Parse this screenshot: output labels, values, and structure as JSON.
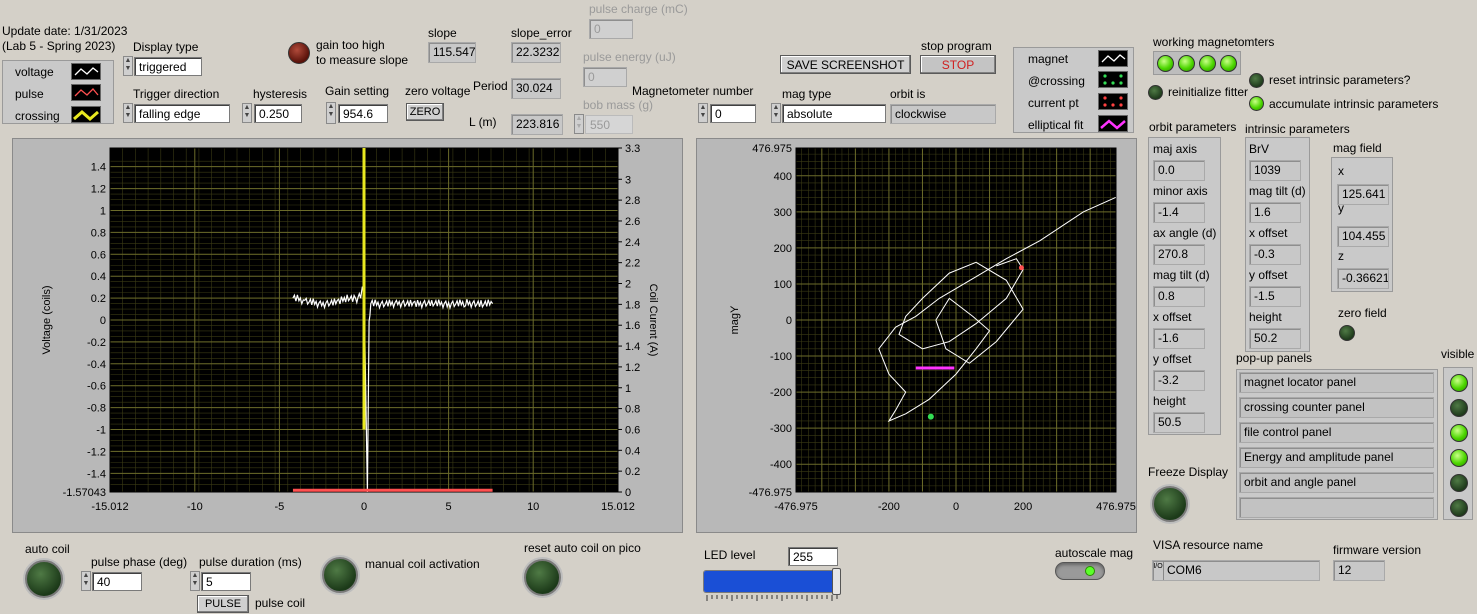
{
  "header": {
    "update_date": "Update date: 1/31/2023",
    "lab": "(Lab 5 - Spring 2023)"
  },
  "legend_left": {
    "items": [
      {
        "label": "voltage"
      },
      {
        "label": "pulse"
      },
      {
        "label": "crossing"
      }
    ]
  },
  "display_type": {
    "label": "Display type",
    "value": "triggered"
  },
  "trigger_direction": {
    "label": "Trigger direction",
    "value": "falling edge"
  },
  "hysteresis": {
    "label": "hysteresis",
    "value": "0.250"
  },
  "gain_setting": {
    "label": "Gain setting",
    "value": "954.6"
  },
  "gain_warning": {
    "line1": "gain too high",
    "line2": "to measure slope"
  },
  "zero_voltage": {
    "label": "zero voltage",
    "button": "ZERO"
  },
  "slope": {
    "label": "slope",
    "value": "115.547"
  },
  "slope_error": {
    "label": "slope_error",
    "value": "22.3232"
  },
  "period": {
    "label": "Period",
    "value": "30.024"
  },
  "length": {
    "label": "L (m)",
    "value": "223.816"
  },
  "pulse_charge": {
    "label": "pulse charge (mC)",
    "value": "0"
  },
  "pulse_energy": {
    "label": "pulse energy (uJ)",
    "value": "0"
  },
  "bob_mass": {
    "label": "bob mass (g)",
    "value": "550"
  },
  "magnetometer_number": {
    "label": "Magnetometer number",
    "value": "0"
  },
  "mag_type": {
    "label": "mag type",
    "value": "absolute"
  },
  "orbit_is": {
    "label": "orbit is",
    "value": "clockwise"
  },
  "save_screenshot": {
    "label": "SAVE SCREENSHOT"
  },
  "stop_program": {
    "label": "stop program",
    "button": "STOP"
  },
  "legend_right": {
    "items": [
      {
        "label": "magnet"
      },
      {
        "label": "@crossing"
      },
      {
        "label": "current pt"
      },
      {
        "label": "elliptical fit"
      }
    ]
  },
  "working_magnetometers": {
    "label": "working magnetomters",
    "states": [
      true,
      true,
      true,
      true
    ]
  },
  "reinitialize_fitter": {
    "label": "reinitialize fitter"
  },
  "reset_intrinsic": {
    "label": "reset intrinsic parameters?"
  },
  "accumulate_intrinsic": {
    "label": "accumulate intrinsic parameters"
  },
  "orbit_parameters": {
    "title": "orbit parameters",
    "fields": [
      {
        "label": "maj axis",
        "value": "0.0"
      },
      {
        "label": "minor axis",
        "value": "-1.4"
      },
      {
        "label": "ax angle (d)",
        "value": "270.8"
      },
      {
        "label": "mag  tilt (d)",
        "value": "0.8"
      },
      {
        "label": "x offset",
        "value": "-1.6"
      },
      {
        "label": "y offset",
        "value": "-3.2"
      },
      {
        "label": "height",
        "value": "50.5"
      }
    ]
  },
  "intrinsic_parameters": {
    "title": "intrinsic parameters",
    "fields": [
      {
        "label": "BrV",
        "value": "1039"
      },
      {
        "label": "mag tilt (d)",
        "value": "1.6"
      },
      {
        "label": "x offset",
        "value": "-0.3"
      },
      {
        "label": "y offset",
        "value": "-1.5"
      },
      {
        "label": "height",
        "value": "50.2"
      }
    ]
  },
  "mag_field": {
    "title": "mag field",
    "x_label": "x",
    "x": "125.641",
    "y_label": "y",
    "y": "104.455",
    "z_label": "z",
    "z": "-0.36621"
  },
  "zero_field": {
    "label": "zero field"
  },
  "popup_panels": {
    "title": "pop-up panels",
    "visible_label": "visible",
    "items": [
      {
        "label": "magnet locator panel",
        "visible": true
      },
      {
        "label": "crossing counter panel",
        "visible": false
      },
      {
        "label": "file control panel",
        "visible": true
      },
      {
        "label": "Energy and amplitude panel",
        "visible": true
      },
      {
        "label": "orbit and angle panel",
        "visible": false
      },
      {
        "label": "",
        "visible": false
      }
    ]
  },
  "freeze_display": {
    "label": "Freeze Display"
  },
  "auto_coil": {
    "label": "auto coil"
  },
  "pulse_phase": {
    "label": "pulse phase (deg)",
    "value": "40"
  },
  "pulse_duration": {
    "label": "pulse duration (ms)",
    "value": "5"
  },
  "pulse_button": {
    "label": "PULSE",
    "caption": "pulse coil"
  },
  "manual_coil": {
    "label": "manual coil activation"
  },
  "reset_auto_coil": {
    "label": "reset auto coil on pico"
  },
  "led_level": {
    "label": "LED level",
    "value": "255",
    "fraction": 1.0
  },
  "autoscale_mag": {
    "label": "autoscale mag"
  },
  "visa": {
    "label": "VISA resource name",
    "value": "COM6",
    "prefix": "I/O"
  },
  "firmware": {
    "label": "firmware version",
    "value": "12"
  },
  "colors": {
    "plot_bg": "#000000",
    "grid": "#6b6b2a",
    "voltage": "#ffffff",
    "crossing": "#e8e820",
    "pulse": "#ff5050",
    "fit": "#ff33ff",
    "crossing_pt": "#33dd55"
  },
  "chart_data": [
    {
      "type": "line",
      "ylabel": "Voltage (coils)",
      "y2label": "Coil Curent (A)",
      "xlim": [
        -15.012,
        15.012
      ],
      "ylim": [
        -1.57043,
        1.57043
      ],
      "y2lim": [
        0,
        3.3
      ],
      "xticks": [
        "-15.012",
        "-10",
        "-5",
        "0",
        "5",
        "10",
        "15.012"
      ],
      "yticks": [
        "1.4",
        "1.2",
        "1",
        "0.8",
        "0.6",
        "0.4",
        "0.2",
        "0",
        "-0.2",
        "-0.4",
        "-0.6",
        "-0.8",
        "-1",
        "-1.2",
        "-1.4",
        "-1.57043"
      ],
      "y2ticks": [
        "3.3",
        "3",
        "2.8",
        "2.6",
        "2.4",
        "2.2",
        "2",
        "1.8",
        "1.6",
        "1.4",
        "1.2",
        "1",
        "0.8",
        "0.6",
        "0.4",
        "0.2",
        "0"
      ],
      "grid": true,
      "series": [
        {
          "name": "voltage",
          "x": [
            -4.2,
            -3.5,
            -2.5,
            -1.5,
            -1.0,
            -0.5,
            -0.2,
            0.0,
            0.2,
            0.3,
            0.4,
            1.0,
            2.0,
            3.0,
            4.0,
            5.0,
            6.0,
            7.0,
            7.6
          ],
          "y": [
            0.2,
            0.17,
            0.14,
            0.16,
            0.2,
            0.18,
            0.22,
            0.3,
            -1.57,
            -0.05,
            0.15,
            0.14,
            0.15,
            0.14,
            0.15,
            0.14,
            0.15,
            0.14,
            0.15
          ]
        },
        {
          "name": "crossing",
          "x": [
            0.0,
            0.0
          ],
          "y": [
            1.57,
            -1.0
          ]
        },
        {
          "name": "pulse",
          "x": [
            -4.2,
            7.6
          ],
          "y": [
            -1.555,
            -1.555
          ]
        }
      ]
    },
    {
      "type": "scatter",
      "ylabel": "magY",
      "xlim": [
        -476.975,
        476.975
      ],
      "ylim": [
        -476.975,
        476.975
      ],
      "xticks": [
        "-476.975",
        "-200",
        "0",
        "200",
        "476.975"
      ],
      "yticks": [
        "476.975",
        "400",
        "300",
        "200",
        "100",
        "0",
        "-100",
        "-200",
        "-300",
        "-400",
        "-476.975"
      ],
      "grid": true,
      "series": [
        {
          "name": "magnet",
          "x": [
            476,
            380,
            250,
            150,
            60,
            -50,
            -120,
            -180,
            -230,
            -200,
            -150,
            -180,
            -200,
            -150,
            -80,
            0,
            60,
            100,
            50,
            -20,
            -60,
            -30,
            40,
            120,
            200,
            150,
            60,
            -20,
            -100,
            -150,
            -170,
            -100,
            -20,
            60,
            150,
            200,
            180,
            120
          ],
          "y": [
            340,
            300,
            220,
            170,
            120,
            60,
            10,
            -20,
            -80,
            -150,
            -200,
            -250,
            -280,
            -260,
            -220,
            -150,
            -80,
            -30,
            10,
            60,
            0,
            -80,
            -120,
            -60,
            30,
            110,
            160,
            130,
            60,
            10,
            -40,
            -80,
            -60,
            -10,
            60,
            140,
            170,
            150
          ]
        },
        {
          "name": "current pt",
          "x": [
            195
          ],
          "y": [
            145
          ]
        },
        {
          "name": "@crossing",
          "x": [
            -75
          ],
          "y": [
            -268
          ]
        },
        {
          "name": "elliptical fit",
          "x": [
            -120,
            -5
          ],
          "y": [
            -133,
            -133
          ]
        }
      ]
    }
  ]
}
